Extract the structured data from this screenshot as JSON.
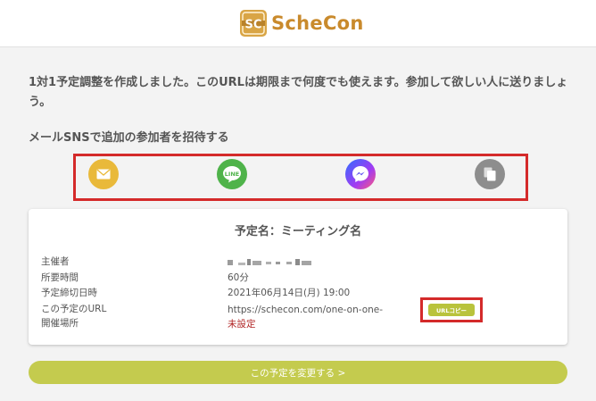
{
  "header": {
    "logo_text": "ScheCon",
    "logo_mark_text": "SC",
    "brand_color": "#c98a2c"
  },
  "message": "1対1予定調整を作成しました。このURLは期限まで何度でも使えます。参加して欲しい人に送りましょう。",
  "invite": {
    "heading": "メールSNSで追加の参加者を招待する",
    "buttons": [
      {
        "name": "mail",
        "icon": "envelope-icon",
        "color": "#e9b93a"
      },
      {
        "name": "line",
        "icon": "line-icon",
        "label": "LINE",
        "color": "#4fb34a"
      },
      {
        "name": "messenger",
        "icon": "messenger-icon",
        "color": "#2f6dff"
      },
      {
        "name": "copy",
        "icon": "copy-icon",
        "color": "#8d8d8d"
      }
    ]
  },
  "card": {
    "title": "予定名：ミーティング名",
    "rows": [
      {
        "label": "主催者",
        "value": ""
      },
      {
        "label": "所要時間",
        "value": "60分"
      },
      {
        "label": "予定締切日時",
        "value": "2021年06月14日(月) 19:00"
      },
      {
        "label": "この予定のURL",
        "value": "https://schecon.com/one-on-one-"
      },
      {
        "label": "開催場所",
        "value": "未設定"
      }
    ],
    "copy_button": "URLコピー",
    "alert_color": "#b02323"
  },
  "change_button": "この予定を変更する >",
  "accent_color": "#c4cb4e",
  "highlight_color": "#d42a2a"
}
